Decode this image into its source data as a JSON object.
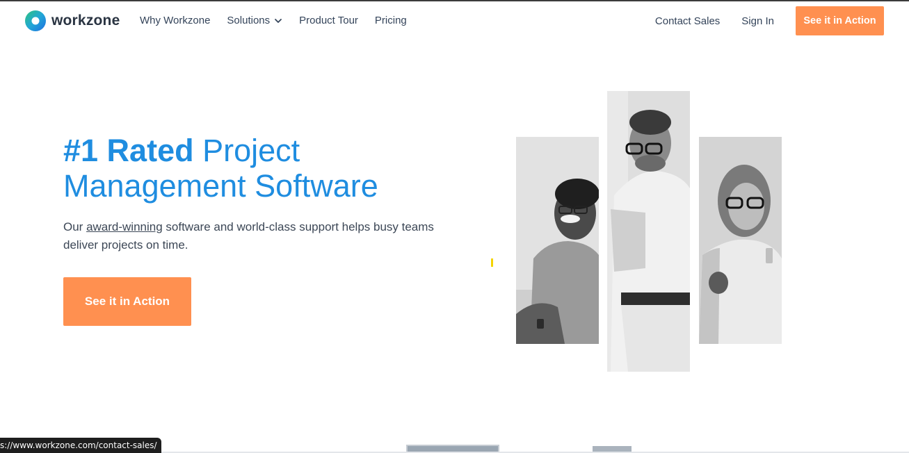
{
  "brand": {
    "name": "workzone"
  },
  "nav": {
    "left": [
      {
        "label": "Why Workzone"
      },
      {
        "label": "Solutions"
      },
      {
        "label": "Product Tour"
      },
      {
        "label": "Pricing"
      }
    ],
    "contact_sales": "Contact Sales",
    "sign_in": "Sign In",
    "cta": "See it in Action"
  },
  "hero": {
    "title_strong": "#1 Rated",
    "title_rest_line1": " Project",
    "title_line2": "Management Software",
    "sub_before": "Our ",
    "sub_link": "award-winning",
    "sub_after": " software and world-class support helps busy teams deliver projects on time.",
    "cta": "See it in Action"
  },
  "status_url": "s://www.workzone.com/contact-sales/",
  "colors": {
    "accent": "#1f8de0",
    "cta": "#ff9050",
    "text": "#34445a"
  },
  "icons": {
    "logo": "workzone-logo-icon",
    "solutions_dropdown": "chevron-down-icon"
  }
}
